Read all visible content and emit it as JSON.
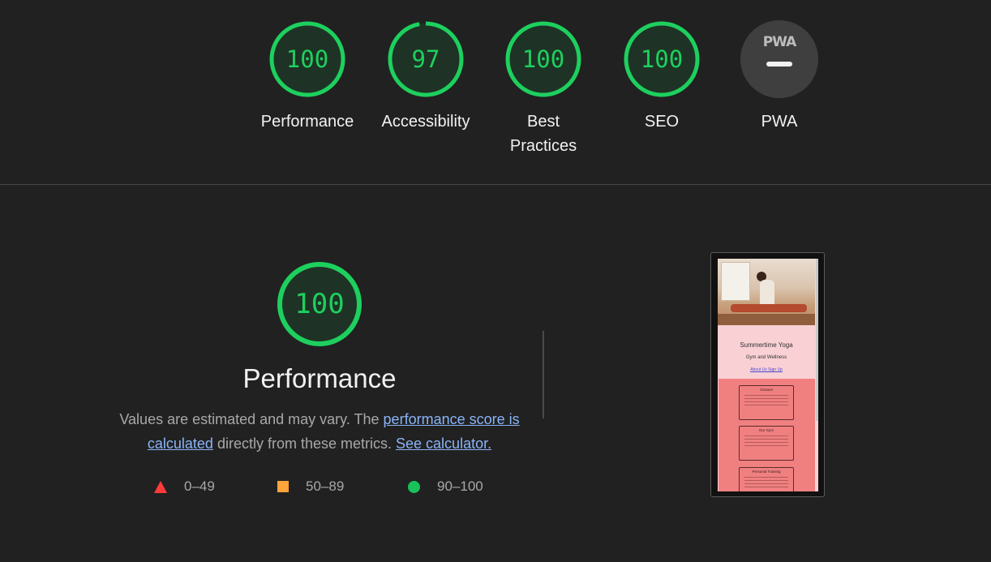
{
  "categories": [
    {
      "name": "Performance",
      "score": "100",
      "value": 100
    },
    {
      "name": "Accessibility",
      "score": "97",
      "value": 97
    },
    {
      "name": "Best Practices",
      "score": "100",
      "value": 100
    },
    {
      "name": "SEO",
      "score": "100",
      "value": 100
    }
  ],
  "pwa": {
    "badge_text": "PWA",
    "label": "PWA"
  },
  "performance": {
    "score": "100",
    "value": 100,
    "title": "Performance",
    "desc_prefix": "Values are estimated and may vary. The ",
    "link_score": "performance score is calculated",
    "desc_mid": " directly from these metrics. ",
    "link_calc": "See calculator."
  },
  "legend": [
    {
      "range": "0–49",
      "icon": "triangle",
      "color": "#ff3b3b"
    },
    {
      "range": "50–89",
      "icon": "square",
      "color": "#ffa43b"
    },
    {
      "range": "90–100",
      "icon": "circle",
      "color": "#17c25a"
    }
  ],
  "screenshot": {
    "title": "Summertime Yoga",
    "subtitle": "Gym and Wellness",
    "links": "About Us  Sign Up",
    "cards": [
      "Classes",
      "Our Gym",
      "Personal Training"
    ]
  },
  "colors": {
    "pass": "#1dd05e",
    "pass_bg": "#1f3a28",
    "background": "#212121"
  }
}
